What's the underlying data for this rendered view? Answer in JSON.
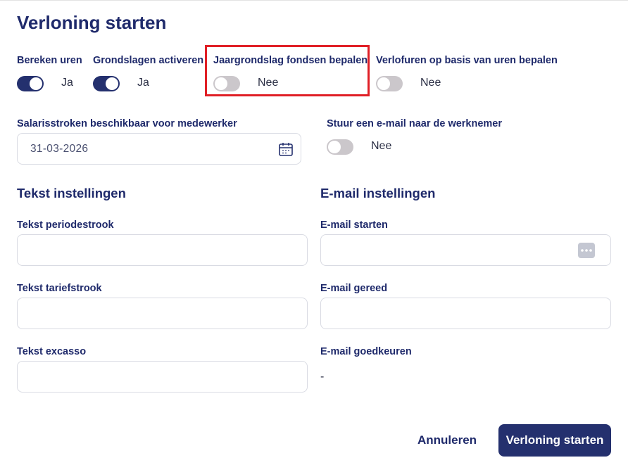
{
  "dialog": {
    "title": "Verloning starten"
  },
  "toggles": {
    "bereken_uren": {
      "label": "Bereken uren",
      "value": "Ja",
      "on": true
    },
    "grondslagen": {
      "label": "Grondslagen activeren",
      "value": "Ja",
      "on": true
    },
    "jaargrondslag": {
      "label": "Jaargrondslag fondsen bepalen",
      "value": "Nee",
      "on": false
    },
    "verlofuren": {
      "label": "Verlofuren op basis van uren bepalen",
      "value": "Nee",
      "on": false
    },
    "email_werknemer": {
      "label": "Stuur een e-mail naar de werknemer",
      "value": "Nee",
      "on": false
    }
  },
  "salarisstroken": {
    "label": "Salarisstroken beschikbaar voor medewerker",
    "date": "31-03-2026"
  },
  "tekst_instellingen": {
    "title": "Tekst instellingen",
    "periodestrook_label": "Tekst periodestrook",
    "periodestrook_value": "",
    "tariefstrook_label": "Tekst tariefstrook",
    "tariefstrook_value": "",
    "excasso_label": "Tekst excasso",
    "excasso_value": ""
  },
  "email_instellingen": {
    "title": "E-mail instellingen",
    "starten_label": "E-mail starten",
    "starten_value": "",
    "gereed_label": "E-mail gereed",
    "gereed_value": "",
    "goedkeuren_label": "E-mail goedkeuren",
    "goedkeuren_value": "-"
  },
  "footer": {
    "cancel_label": "Annuleren",
    "submit_label": "Verloning starten"
  },
  "icons": {
    "calendar": "calendar-icon",
    "more": "more-dots-icon"
  },
  "colors": {
    "primary": "#24306e",
    "highlight": "#e01f26",
    "toggle_off": "#cbc7cb"
  }
}
